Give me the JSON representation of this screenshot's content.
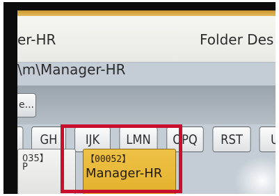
{
  "screen": {
    "name_fragment": "er-HR",
    "folder_label_fragment": "Folder Des",
    "path_fragment": "\\m\\Manager-HR",
    "small_button_label": "e..."
  },
  "tabs": [
    {
      "label": "C"
    },
    {
      "label": "GH"
    },
    {
      "label": "IJK"
    },
    {
      "label": "LMN"
    },
    {
      "label": "OPQ"
    },
    {
      "label": "RST"
    },
    {
      "label": "U"
    }
  ],
  "entries": [
    {
      "code": "035】",
      "sub": "P"
    },
    {
      "code": "【00052】",
      "label": "Manager-HR"
    }
  ],
  "colors": {
    "selected_tile": "#e9b93a",
    "highlight_box": "#c8102e",
    "top_bar": "#d4a43f"
  }
}
